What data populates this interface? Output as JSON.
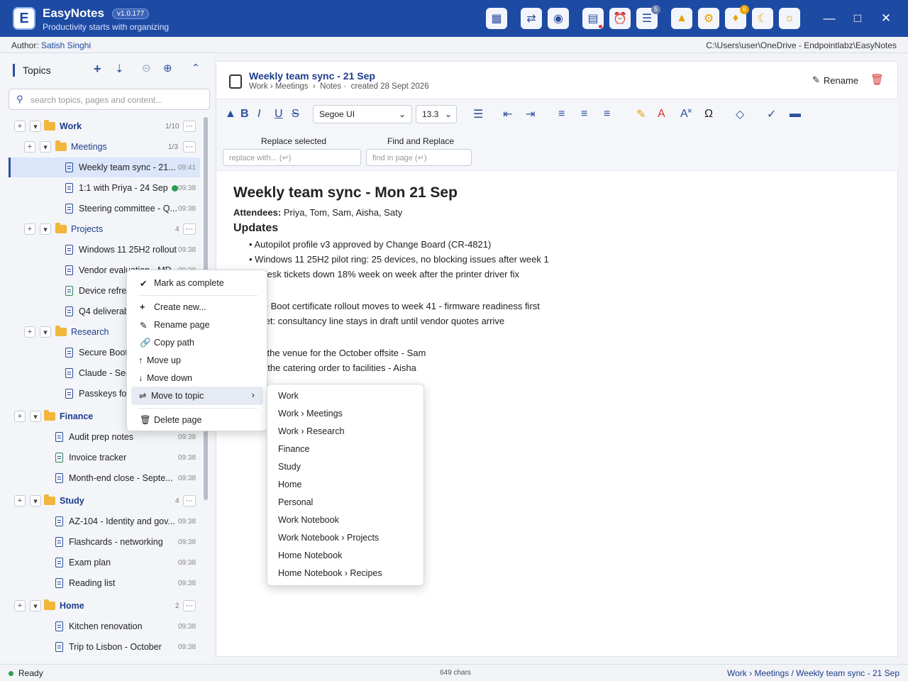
{
  "app": {
    "name": "EasyNotes",
    "version": "v1.0.177",
    "tagline": "Productivity starts with organizing"
  },
  "toolbar_badges": {
    "tasks": "5",
    "alerts": "6"
  },
  "colors": {
    "titlebar": "#1d4aa3",
    "accent": "#2b4ea0",
    "selected_row": "#dbe6fb"
  },
  "author": {
    "label": "Author:",
    "name": "Satish Singhi"
  },
  "path": "C:\\Users\\user\\OneDrive - Endpointlabz\\EasyNotes",
  "sidebar": {
    "title": "Topics",
    "search_placeholder": "search topics, pages and content...",
    "work": {
      "name": "Work",
      "count": "1/10"
    },
    "meetings": {
      "name": "Meetings",
      "count": "1/3"
    },
    "p_weekly": {
      "title": "Weekly team sync - 21...",
      "time": "09:41"
    },
    "p_11": {
      "title": "1:1 with Priya - 24 Sep",
      "time": "09:38"
    },
    "p_steer": {
      "title": "Steering committee - Q...",
      "time": "09:38"
    },
    "projects": {
      "name": "Projects",
      "count": "4"
    },
    "p_win": {
      "title": "Windows 11 25H2 rollout",
      "time": "09:38"
    },
    "p_vendor": {
      "title": "Vendor evaluation - MD...",
      "time": "09:38"
    },
    "p_device": {
      "title": "Device refres"
    },
    "p_q4": {
      "title": "Q4 deliverab"
    },
    "research": {
      "name": "Research"
    },
    "p_secure": {
      "title": "Secure Boot"
    },
    "p_claude": {
      "title": "Claude - Sec"
    },
    "p_passkeys": {
      "title": "Passkeys for"
    },
    "finance": {
      "name": "Finance"
    },
    "p_audit": {
      "title": "Audit prep notes",
      "time": "09:38"
    },
    "p_invoice": {
      "title": "Invoice tracker",
      "time": "09:38"
    },
    "p_month": {
      "title": "Month-end close - Septe...",
      "time": "09:38"
    },
    "study": {
      "name": "Study",
      "count": "4"
    },
    "p_az": {
      "title": "AZ-104 - Identity and gov...",
      "time": "09:38"
    },
    "p_flash": {
      "title": "Flashcards - networking",
      "time": "09:38"
    },
    "p_exam": {
      "title": "Exam plan",
      "time": "09:38"
    },
    "p_reading": {
      "title": "Reading list",
      "time": "09:38"
    },
    "home": {
      "name": "Home",
      "count": "2"
    },
    "p_kitchen": {
      "title": "Kitchen renovation",
      "time": "09:38"
    },
    "p_lisbon": {
      "title": "Trip to Lisbon - October",
      "time": "09:38"
    }
  },
  "page": {
    "title": "Weekly team sync - 21 Sep",
    "crumb_topic": "Work › Meetings",
    "crumb_sep": "›",
    "crumb_sub": "Notes",
    "crumb_created": "created 28 Sept 2026",
    "rename": "Rename"
  },
  "editor_toolbar": {
    "font": "Segoe UI",
    "size": "13.3",
    "replace_label": "Replace selected",
    "replace_placeholder": "replace with... (↵)",
    "find_label": "Find and Replace",
    "find_placeholder": "find in page (↵)"
  },
  "content": {
    "heading": "Weekly team sync - Mon 21 Sep",
    "attendees_label": "Attendees:",
    "attendees": "Priya, Tom, Sam, Aisha, Saty",
    "updates_heading": "Updates",
    "u1": "Autopilot profile v3 approved by Change Board (CR-4821)",
    "u2": "Windows 11 25H2 pilot ring: 25 devices, no blocking issues after week 1",
    "u3": "lpdesk tickets down 18% week on week after the printer driver fix",
    "decisions_heading": "ons",
    "d1": "ure Boot certificate rollout moves to week 41 - firmware readiness first",
    "d2": "dget: consultancy line stays in draft until vendor quotes arrive",
    "actions_heading": "s",
    "a1": "ok the venue for the October offsite - Sam",
    "a2": "nd the catering order to facilities - Aisha",
    "a5": "m"
  },
  "context_menu": {
    "mark_complete": "Mark as complete",
    "create_new": "Create new...",
    "rename_page": "Rename page",
    "copy_path": "Copy path",
    "move_up": "Move up",
    "move_down": "Move down",
    "move_to_topic": "Move to topic",
    "delete_page": "Delete page"
  },
  "submenu": [
    "Work",
    "Work › Meetings",
    "Work › Research",
    "Finance",
    "Study",
    "Home",
    "Personal",
    "Work Notebook",
    "Work Notebook › Projects",
    "Home Notebook",
    "Home Notebook › Recipes"
  ],
  "status": {
    "ready": "Ready",
    "chars": "649 chars",
    "crumb_topic": "Work › Meetings",
    "crumb_sep": " / ",
    "crumb_page": "Weekly team sync - 21 Sep"
  }
}
